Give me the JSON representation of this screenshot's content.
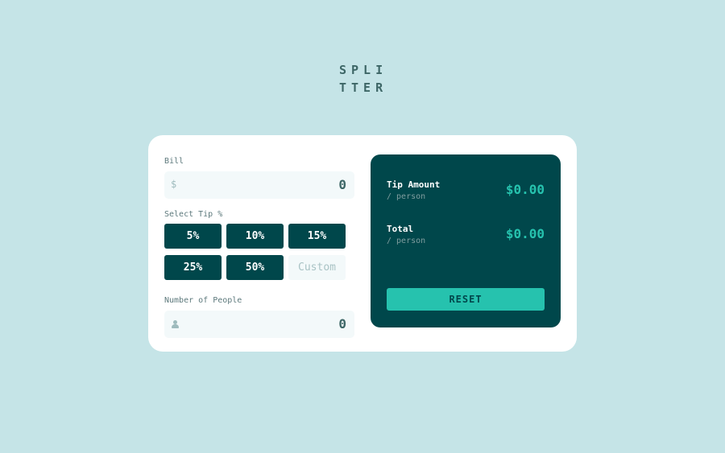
{
  "logo": {
    "line1": "SPLI",
    "line2": "TTER"
  },
  "bill": {
    "label": "Bill",
    "currency_icon": "$",
    "value": "0"
  },
  "tip": {
    "label": "Select Tip %",
    "options": [
      "5%",
      "10%",
      "15%",
      "25%",
      "50%"
    ],
    "custom_placeholder": "Custom"
  },
  "people": {
    "label": "Number of People",
    "icon": "person-icon",
    "value": "0"
  },
  "results": {
    "tip_title": "Tip Amount",
    "tip_sub": "/ person",
    "tip_value": "$0.00",
    "total_title": "Total",
    "total_sub": "/ person",
    "total_value": "$0.00",
    "reset_label": "RESET"
  },
  "colors": {
    "background": "#c5e4e7",
    "dark_cyan": "#00474b",
    "strong_cyan": "#26c2ae",
    "card": "#ffffff"
  }
}
